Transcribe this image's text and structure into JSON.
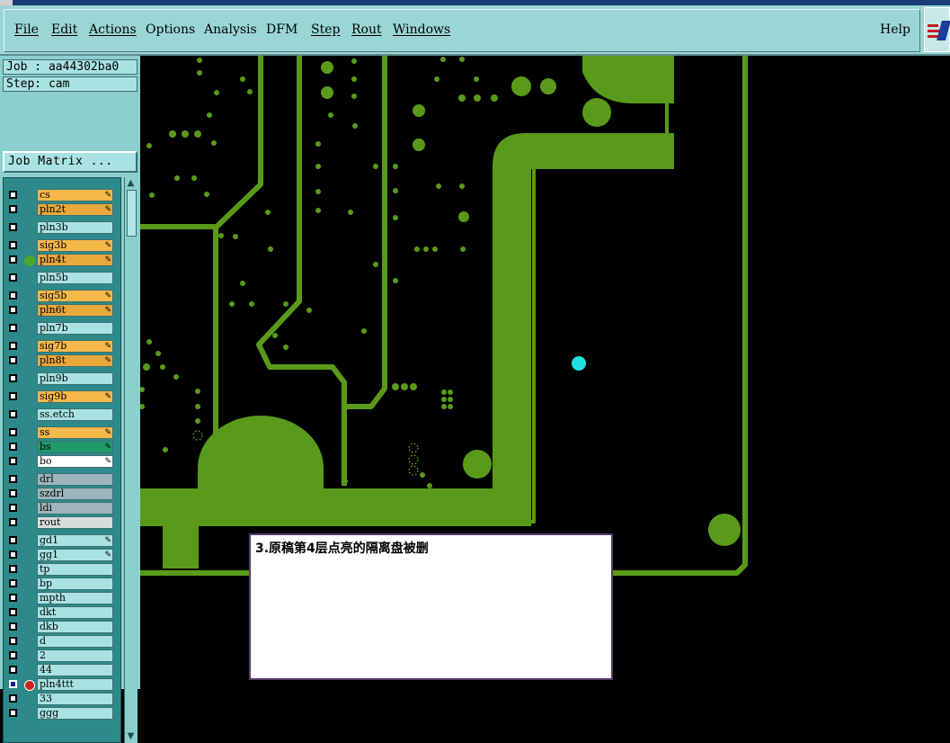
{
  "menu": {
    "file": "File",
    "edit": "Edit",
    "actions": "Actions",
    "options": "Options",
    "analysis": "Analysis",
    "dfm": "DFM",
    "step": "Step",
    "rout": "Rout",
    "windows": "Windows",
    "help": "Help"
  },
  "job": {
    "label": "Job : aa44302ba0",
    "step": "Step: cam"
  },
  "job_matrix_button": "Job Matrix ...",
  "layers": [
    {
      "name": "cs",
      "color": "#f5b84a",
      "editable": true
    },
    {
      "name": "pln2t",
      "color": "#e8a83c",
      "editable": true
    },
    {
      "name": "pln3b",
      "color": "#a9e2e2",
      "editable": false
    },
    {
      "name": "sig3b",
      "color": "#f5b84a",
      "editable": true
    },
    {
      "name": "pln4t",
      "color": "#e8a83c",
      "editable": true,
      "active": true
    },
    {
      "name": "pln5b",
      "color": "#a9e2e2",
      "editable": false
    },
    {
      "name": "sig5b",
      "color": "#f5b84a",
      "editable": true
    },
    {
      "name": "pln6t",
      "color": "#e8a83c",
      "editable": true
    },
    {
      "name": "pln7b",
      "color": "#a9e2e2",
      "editable": false
    },
    {
      "name": "sig7b",
      "color": "#f5b84a",
      "editable": true
    },
    {
      "name": "pln8t",
      "color": "#e8a83c",
      "editable": true
    },
    {
      "name": "pln9b",
      "color": "#a9e2e2",
      "editable": false
    },
    {
      "name": "sig9b",
      "color": "#f5b84a",
      "editable": true
    },
    {
      "name": "ss.etch",
      "color": "#a9e2e2",
      "editable": false
    },
    {
      "name": "ss",
      "color": "#f5b84a",
      "editable": true
    },
    {
      "name": "bs",
      "color": "#1f9a6a",
      "editable": true
    },
    {
      "name": "bo",
      "color": "#ffffff",
      "editable": true
    },
    {
      "name": "drl",
      "color": "#9fb4bc",
      "editable": false
    },
    {
      "name": "szdrl",
      "color": "#9fb4bc",
      "editable": false
    },
    {
      "name": "ldi",
      "color": "#9fb4bc",
      "editable": false
    },
    {
      "name": "rout",
      "color": "#d8dcdc",
      "editable": false
    },
    {
      "name": "gd1",
      "color": "#a9e2e2",
      "editable": true
    },
    {
      "name": "gg1",
      "color": "#a9e2e2",
      "editable": true
    },
    {
      "name": "tp",
      "color": "#a9e2e2",
      "editable": false
    },
    {
      "name": "bp",
      "color": "#a9e2e2",
      "editable": false
    },
    {
      "name": "mpth",
      "color": "#a9e2e2",
      "editable": false
    },
    {
      "name": "dkt",
      "color": "#a9e2e2",
      "editable": false
    },
    {
      "name": "dkb",
      "color": "#a9e2e2",
      "editable": false
    },
    {
      "name": "d",
      "color": "#a9e2e2",
      "editable": false
    },
    {
      "name": "2",
      "color": "#a9e2e2",
      "editable": false
    },
    {
      "name": "44",
      "color": "#a9e2e2",
      "editable": false
    },
    {
      "name": "pln4ttt",
      "color": "#a9e2e2",
      "editable": false,
      "checked": true,
      "marker": true
    },
    {
      "name": "33",
      "color": "#a9e2e2",
      "editable": false
    },
    {
      "name": "ggg",
      "color": "#a9e2e2",
      "editable": false
    }
  ],
  "note": {
    "text": "3.原稿第4层点亮的隔离盘被删"
  },
  "colors": {
    "copper": "#5a9a1a",
    "highlight_pad": "#22e0e0",
    "background": "#000000",
    "panel": "#8ccfcf"
  }
}
